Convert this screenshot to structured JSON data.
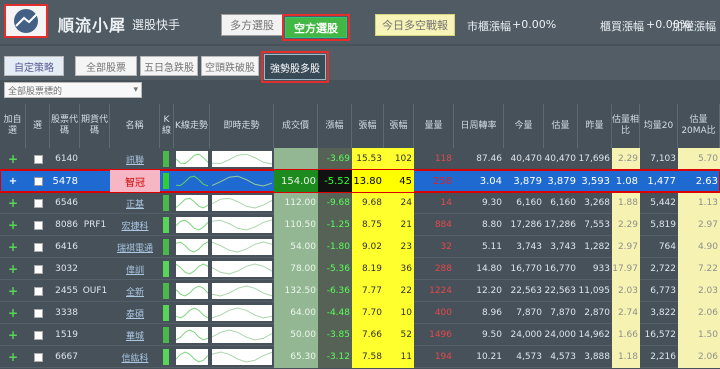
{
  "header": {
    "logo_text": "順流小犀",
    "logo_sub": "選股快手",
    "long_btn": "多方選股",
    "short_btn": "空方選股",
    "today_btn": "今日多空戰報",
    "idx1_label": "市櫃漲幅",
    "idx1_value": "+0.00%",
    "idx2_label": "櫃買漲幅",
    "idx2_value": "+0.00%",
    "idx3_label": "加權漲幅"
  },
  "subbar": {
    "custom": "自定策略",
    "all": "全部股票",
    "five_day": "五日急跌股",
    "cross": "空頭跌破股",
    "strong": "強勢股多股",
    "filter": "全部股票標的"
  },
  "columns": [
    "加自選",
    "選",
    "股票代碼",
    "期貨代碼",
    "名稱",
    "K線",
    "K線走勢",
    "即時走勢",
    "成交價",
    "漲幅",
    "張幅",
    "張幅",
    "量量",
    "日周轉率",
    "今量",
    "估量",
    "昨量",
    "估量相比",
    "均量20",
    "估量20MA比"
  ],
  "rows": [
    {
      "code": "6140",
      "fut": "",
      "name": "訊聯",
      "price": "",
      "chg": "-3.69",
      "p1": "15.53",
      "p2": "102",
      "vol": "118",
      "turn": "87.46",
      "v1": "40,470",
      "v2": "40,470",
      "v3": "17,696",
      "ratio": "2.29",
      "avg": "7,103",
      "ma": "5.70"
    },
    {
      "code": "5478",
      "fut": "",
      "name": "智冠",
      "price": "154.00",
      "chg": "-5.52",
      "p1": "13.80",
      "p2": "45",
      "vol": "258",
      "turn": "3.04",
      "v1": "3,879",
      "v2": "3,879",
      "v3": "3,593",
      "ratio": "1.08",
      "avg": "1,477",
      "ma": "2.63"
    },
    {
      "code": "6546",
      "fut": "",
      "name": "正基",
      "price": "112.00",
      "chg": "-9.68",
      "p1": "9.68",
      "p2": "24",
      "vol": "14",
      "turn": "9.30",
      "v1": "6,160",
      "v2": "6,160",
      "v3": "3,268",
      "ratio": "1.88",
      "avg": "5,442",
      "ma": "1.13"
    },
    {
      "code": "8086",
      "fut": "PRF1",
      "name": "宏捷科",
      "price": "110.50",
      "chg": "-1.25",
      "p1": "8.75",
      "p2": "21",
      "vol": "884",
      "turn": "8.80",
      "v1": "17,286",
      "v2": "17,286",
      "v3": "7,553",
      "ratio": "2.29",
      "avg": "5,819",
      "ma": "2.97"
    },
    {
      "code": "6416",
      "fut": "",
      "name": "瑞祺電通",
      "price": "54.00",
      "chg": "-1.80",
      "p1": "9.02",
      "p2": "23",
      "vol": "32",
      "turn": "5.11",
      "v1": "3,743",
      "v2": "3,743",
      "v3": "1,282",
      "ratio": "2.97",
      "avg": "764",
      "ma": "4.90"
    },
    {
      "code": "3032",
      "fut": "",
      "name": "偉訓",
      "price": "78.00",
      "chg": "-5.36",
      "p1": "8.19",
      "p2": "36",
      "vol": "288",
      "turn": "14.80",
      "v1": "16,770",
      "v2": "16,770",
      "v3": "933",
      "ratio": "17.97",
      "avg": "2,722",
      "ma": "7.22"
    },
    {
      "code": "2455",
      "fut": "OUF1",
      "name": "全新",
      "price": "132.50",
      "chg": "-6.36",
      "p1": "7.77",
      "p2": "22",
      "vol": "1224",
      "turn": "12.20",
      "v1": "22,563",
      "v2": "22,563",
      "v3": "11,095",
      "ratio": "2.03",
      "avg": "6,773",
      "ma": "2.03"
    },
    {
      "code": "3338",
      "fut": "",
      "name": "泰碩",
      "price": "64.00",
      "chg": "-4.48",
      "p1": "7.70",
      "p2": "10",
      "vol": "400",
      "turn": "8.96",
      "v1": "7,870",
      "v2": "7,870",
      "v3": "2,870",
      "ratio": "2.74",
      "avg": "3,822",
      "ma": "2.06"
    },
    {
      "code": "1519",
      "fut": "",
      "name": "華城",
      "price": "50.00",
      "chg": "-3.85",
      "p1": "7.66",
      "p2": "52",
      "vol": "1496",
      "turn": "9.50",
      "v1": "24,000",
      "v2": "24,000",
      "v3": "14,962",
      "ratio": "1.66",
      "avg": "16,572",
      "ma": "1.50"
    },
    {
      "code": "6667",
      "fut": "",
      "name": "信紘科",
      "price": "65.30",
      "chg": "-3.12",
      "p1": "7.58",
      "p2": "11",
      "vol": "194",
      "turn": "10.21",
      "v1": "4,573",
      "v2": "4,573",
      "v3": "3,888",
      "ratio": "1.18",
      "avg": "2,216",
      "ma": "2.06"
    }
  ],
  "colors": {
    "selected_row": "#1e6ad0",
    "highlight_red": "#dd0000",
    "short_green": "#1aa81a"
  }
}
